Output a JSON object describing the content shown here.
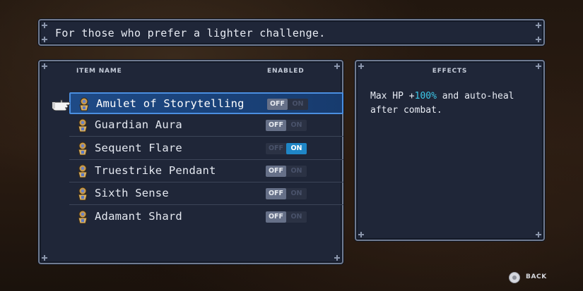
{
  "description": {
    "text": "For those who prefer a lighter challenge."
  },
  "items_panel": {
    "col_item_name": "ITEM NAME",
    "col_enabled": "ENABLED",
    "toggle_off_label": "OFF",
    "toggle_on_label": "ON",
    "items": [
      {
        "name": "Amulet of Storytelling",
        "enabled": false,
        "selected": true
      },
      {
        "name": "Guardian Aura",
        "enabled": false,
        "selected": false
      },
      {
        "name": "Sequent Flare",
        "enabled": true,
        "selected": false
      },
      {
        "name": "Truestrike Pendant",
        "enabled": false,
        "selected": false
      },
      {
        "name": "Sixth Sense",
        "enabled": false,
        "selected": false
      },
      {
        "name": "Adamant Shard",
        "enabled": false,
        "selected": false
      }
    ]
  },
  "effects_panel": {
    "title": "EFFECTS",
    "text_before": "Max HP +",
    "highlight": "100%",
    "text_after": " and auto-heal after combat."
  },
  "footer": {
    "back_label": "BACK",
    "back_icon": "circle-button-icon"
  },
  "colors": {
    "accent": "#1f86c6",
    "highlight_text": "#3cc8e8",
    "selection": "#1e4a86"
  }
}
